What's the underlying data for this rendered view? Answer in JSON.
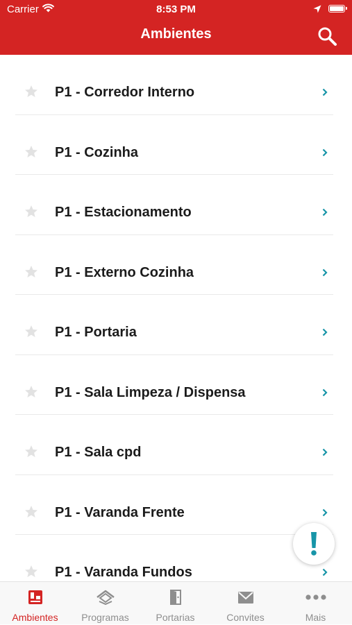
{
  "status_bar": {
    "carrier": "Carrier",
    "time": "8:53 PM"
  },
  "header": {
    "title": "Ambientes"
  },
  "colors": {
    "accent": "#d42423",
    "chevron": "#1795a8",
    "star": "#e2e2e2",
    "tab_inactive": "#8e8e8e"
  },
  "list": {
    "items": [
      {
        "label": "P1 - Corredor Interno"
      },
      {
        "label": "P1 - Cozinha"
      },
      {
        "label": "P1 - Estacionamento"
      },
      {
        "label": "P1 - Externo Cozinha"
      },
      {
        "label": "P1 - Portaria"
      },
      {
        "label": "P1 - Sala Limpeza / Dispensa"
      },
      {
        "label": "P1 - Sala cpd"
      },
      {
        "label": "P1 - Varanda Frente"
      },
      {
        "label": "P1 - Varanda Fundos"
      }
    ]
  },
  "fab": {
    "icon": "exclamation-icon"
  },
  "tabbar": {
    "tabs": [
      {
        "label": "Ambientes",
        "icon": "ambientes-icon",
        "active": true
      },
      {
        "label": "Programas",
        "icon": "programas-icon",
        "active": false
      },
      {
        "label": "Portarias",
        "icon": "portarias-icon",
        "active": false
      },
      {
        "label": "Convites",
        "icon": "convites-icon",
        "active": false
      },
      {
        "label": "Mais",
        "icon": "more-dots-icon",
        "active": false
      }
    ]
  }
}
